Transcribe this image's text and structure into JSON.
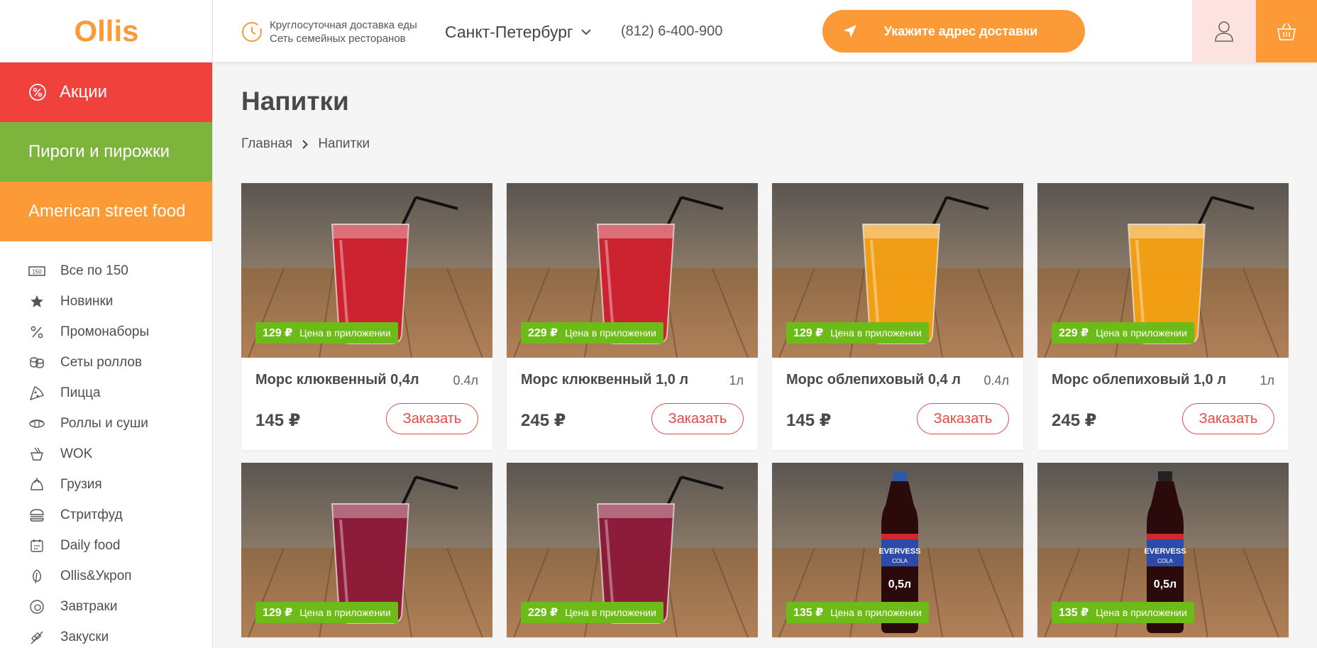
{
  "brand": {
    "logo_text": "Ollis",
    "color": "#fb9a36"
  },
  "header": {
    "tagline_line1": "Круглосуточная доставка еды",
    "tagline_line2": "Сеть семейных ресторанов",
    "city": "Санкт-Петербург",
    "phone": "(812) 6-400-900",
    "address_button": "Укажите адрес доставки"
  },
  "sidebar": {
    "featured": [
      {
        "label": "Акции",
        "icon": "percent-badge-icon",
        "color": "#f1413c"
      },
      {
        "label": "Пироги и пирожки",
        "color": "#7db53c"
      },
      {
        "label": "American street food",
        "color": "#fb9a36"
      }
    ],
    "items": [
      {
        "label": "Все по 150",
        "icon": "price-150-icon"
      },
      {
        "label": "Новинки",
        "icon": "star-icon"
      },
      {
        "label": "Промонаборы",
        "icon": "percent-icon"
      },
      {
        "label": "Сеты роллов",
        "icon": "rolls-set-icon"
      },
      {
        "label": "Пицца",
        "icon": "pizza-icon"
      },
      {
        "label": "Роллы и суши",
        "icon": "sushi-icon"
      },
      {
        "label": "WOK",
        "icon": "wok-icon"
      },
      {
        "label": "Грузия",
        "icon": "khinkali-icon"
      },
      {
        "label": "Стритфуд",
        "icon": "burger-icon"
      },
      {
        "label": "Daily food",
        "icon": "calendar-icon"
      },
      {
        "label": "Ollis&Укроп",
        "icon": "leaf-icon"
      },
      {
        "label": "Завтраки",
        "icon": "plate-icon"
      },
      {
        "label": "Закуски",
        "icon": "skewer-icon"
      }
    ]
  },
  "page": {
    "title": "Напитки",
    "breadcrumbs": [
      "Главная",
      "Напитки"
    ]
  },
  "products": [
    {
      "name": "Морс клюквенный 0,4л",
      "volume": "0.4л",
      "price": "145 ₽",
      "app_price": "129 ₽",
      "app_note": "Цена в приложении",
      "order": "Заказать",
      "drink": "cranberry",
      "drink_color": "#d01f2e"
    },
    {
      "name": "Морс клюквенный 1,0 л",
      "volume": "1л",
      "price": "245 ₽",
      "app_price": "229 ₽",
      "app_note": "Цена в приложении",
      "order": "Заказать",
      "drink": "cranberry",
      "drink_color": "#d01f2e"
    },
    {
      "name": "Морс облепиховый 0,4 л",
      "volume": "0.4л",
      "price": "145 ₽",
      "app_price": "129 ₽",
      "app_note": "Цена в приложении",
      "order": "Заказать",
      "drink": "seabuckthorn",
      "drink_color": "#f5a012"
    },
    {
      "name": "Морс облепиховый 1,0 л",
      "volume": "1л",
      "price": "245 ₽",
      "app_price": "229 ₽",
      "app_note": "Цена в приложении",
      "order": "Заказать",
      "drink": "seabuckthorn",
      "drink_color": "#f5a012"
    },
    {
      "app_price": "129 ₽",
      "app_note": "Цена в приложении",
      "drink": "berry",
      "drink_color": "#8c1738"
    },
    {
      "app_price": "229 ₽",
      "app_note": "Цена в приложении",
      "drink": "berry",
      "drink_color": "#8c1738"
    },
    {
      "app_price": "135 ₽",
      "app_note": "Цена в приложении",
      "drink": "cola",
      "bottle_label": "0,5л",
      "bottle_brand": "EVERVESS",
      "bottle_sub": "COLA"
    },
    {
      "app_price": "135 ₽",
      "app_note": "Цена в приложении",
      "drink": "cola-zero",
      "bottle_label": "0,5л",
      "bottle_brand": "EVERVESS",
      "bottle_sub": "COLA"
    }
  ]
}
